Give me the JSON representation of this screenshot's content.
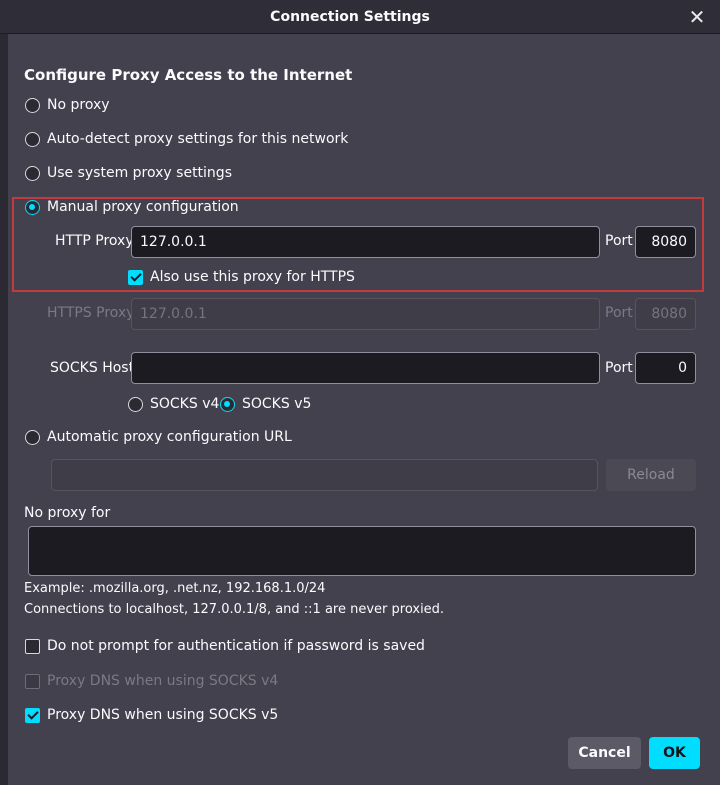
{
  "window": {
    "title": "Connection Settings",
    "close_icon": "close-icon"
  },
  "section_heading": "Configure Proxy Access to the Internet",
  "proxy_options": {
    "no_proxy": "No proxy",
    "auto_detect": "Auto-detect proxy settings for this network",
    "system": "Use system proxy settings",
    "manual": "Manual proxy configuration",
    "auto_url": "Automatic proxy configuration URL",
    "selected": "manual"
  },
  "http": {
    "label": "HTTP Proxy",
    "value": "127.0.0.1",
    "port_label": "Port",
    "port": "8080",
    "also_https": "Also use this proxy for HTTPS"
  },
  "https": {
    "label": "HTTPS Proxy",
    "value": "127.0.0.1",
    "port_label": "Port",
    "port": "8080"
  },
  "socks": {
    "label": "SOCKS Host",
    "value": "",
    "port_label": "Port",
    "port": "0",
    "v4": "SOCKS v4",
    "v5": "SOCKS v5",
    "selected": "v5"
  },
  "auto_url": {
    "value": "",
    "reload": "Reload"
  },
  "no_proxy_for": {
    "label": "No proxy for",
    "value": "",
    "example": "Example: .mozilla.org, .net.nz, 192.168.1.0/24",
    "note": "Connections to localhost, 127.0.0.1/8, and ::1 are never proxied."
  },
  "options": {
    "no_auth_prompt": "Do not prompt for authentication if password is saved",
    "dns_v4": "Proxy DNS when using SOCKS v4",
    "dns_v5": "Proxy DNS when using SOCKS v5"
  },
  "buttons": {
    "cancel": "Cancel",
    "ok": "OK"
  },
  "colors": {
    "accent": "#00ddff",
    "highlight": "#c23a3e",
    "background": "#42414d"
  }
}
